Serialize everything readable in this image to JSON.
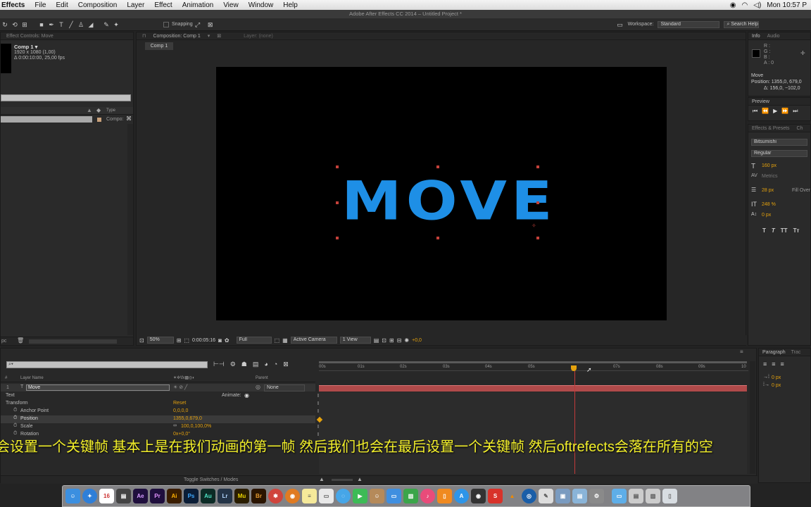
{
  "menubar": {
    "app": "Effects",
    "items": [
      "File",
      "Edit",
      "Composition",
      "Layer",
      "Effect",
      "Animation",
      "View",
      "Window",
      "Help"
    ],
    "clock": "Mon 10:57 P"
  },
  "window_title": "Adobe After Effects CC 2014 – Untitled Project *",
  "toolbar": {
    "snapping": "Snapping",
    "workspace_label": "Workspace:",
    "workspace_value": "Standard",
    "search_help": "Search Help"
  },
  "project_panel": {
    "tab": "Effect Controls: Move",
    "comp_name": "Comp 1 ▾",
    "comp_size": "1920 x 1080 (1,00)",
    "comp_duration": "Δ 0:00:10:00, 25,00 fps",
    "col_type": "Type",
    "row_type": "Compo:",
    "bpc": "pc"
  },
  "comp_panel": {
    "tab": "Composition: Comp 1",
    "layer_tab": "Layer: (none)",
    "sub_tab": "Comp 1",
    "canvas_text": "MOVE",
    "text_color": "#1e8fe6",
    "zoom": "50%",
    "timecode": "0:00:05:16",
    "resolution": "Full",
    "camera": "Active Camera",
    "views": "1 View",
    "exposure": "+0,0"
  },
  "info_panel": {
    "tabs": [
      "Info",
      "Audio"
    ],
    "r": "R :",
    "g": "G :",
    "b": "B :",
    "a": "A : 0",
    "layer": "Move",
    "position": "Position: 1355,0, 679,0",
    "delta": "Δ: 156,0, −102,0"
  },
  "preview_panel": {
    "tab": "Preview"
  },
  "character_panel": {
    "tabs": [
      "Effects & Presets",
      "Ch"
    ],
    "font": "Bitsumishi",
    "style": "Regular",
    "size": "160 px",
    "kerning": "Metrics",
    "stroke": "28 px",
    "fill": "Fill Over",
    "vscale": "248 %",
    "baseline": "0 px"
  },
  "paragraph_panel": {
    "tabs": [
      "Paragraph",
      "Trac"
    ],
    "indent1": "0 px",
    "indent2": "0 px"
  },
  "timeline": {
    "search_placeholder": "",
    "col_layer": "Layer Name",
    "col_parent": "Parent",
    "layer_num": "1",
    "layer_name": "Move",
    "parent_value": "None",
    "text_group": "Text",
    "animate": "Animate:",
    "transform": "Transform",
    "reset": "Reset",
    "props": [
      {
        "name": "Anchor Point",
        "value": "0,0,0,0"
      },
      {
        "name": "Position",
        "value": "1355,0,679,0"
      },
      {
        "name": "Scale",
        "value": "100,0,100,0%"
      },
      {
        "name": "Rotation",
        "value": "0x+0,0°"
      }
    ],
    "ruler": [
      "00s",
      "01s",
      "02s",
      "03s",
      "04s",
      "05s",
      "",
      "07s",
      "08s",
      "09s",
      "10"
    ],
    "playhead_fraction": 0.5965,
    "toggle": "Toggle Switches / Modes"
  },
  "subtitle": "会设置一个关键帧 基本上是在我们动画的第一帧 然后我们也会在最后设置一个关键帧 然后oftrefects会落在所有的空",
  "dock": [
    "Ae",
    "Pr",
    "Ai",
    "Ps",
    "Au",
    "Lr",
    "Mu",
    "Br"
  ]
}
